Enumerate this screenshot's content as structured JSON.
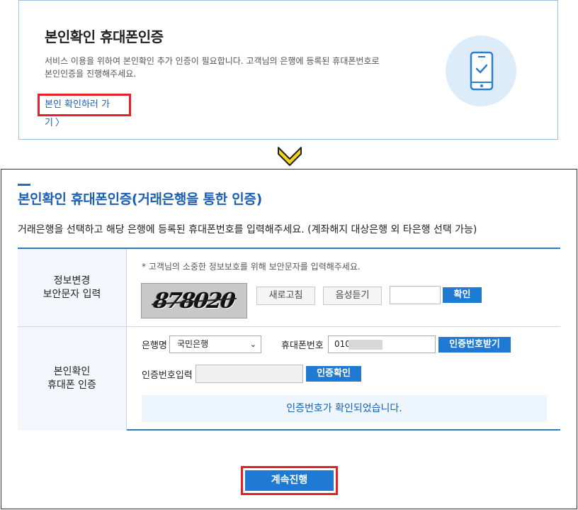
{
  "card": {
    "title": "본인확인 휴대폰인증",
    "desc_line1": "서비스 이용을 위하여 본인확인 추가 인증이 필요합니다. 고객님의 은행에 등록된 휴대폰번호로",
    "desc_line2": "본인인증을 진행해주세요.",
    "link_label": "본인 확인하러 가기",
    "link_chevron": "〉"
  },
  "panel": {
    "title": "본인확인 휴대폰인증(거래은행을 통한 인증)",
    "subtitle": "거래은행을 선택하고 해당 은행에 등록된 휴대폰번호를 입력해주세요. (계좌해지 대상은행 외 타은행 선택 가능)"
  },
  "security": {
    "header_line1": "정보변경",
    "header_line2": "보안문자 입력",
    "notice": "* 고객님의 소중한 정보보호를 위해 보안문자를 입력해주세요.",
    "captcha_text": "878020",
    "refresh_label": "새로고침",
    "audio_label": "음성듣기",
    "confirm_label": "확인"
  },
  "verify": {
    "header_line1": "본인확인",
    "header_line2": "휴대폰 인증",
    "bank_label": "은행명",
    "bank_selected": "국민은행",
    "phone_label": "휴대폰번호",
    "phone_value": "010",
    "request_code_label": "인증번호받기",
    "code_label": "인증번호입력",
    "confirm_code_label": "인증확인",
    "success_message": "인증번호가 확인되었습니다."
  },
  "continue_label": "계속진행",
  "colors": {
    "accent_blue": "#1e7ad2",
    "highlight_red": "#e32129",
    "arrow_yellow": "#f5d31a"
  }
}
